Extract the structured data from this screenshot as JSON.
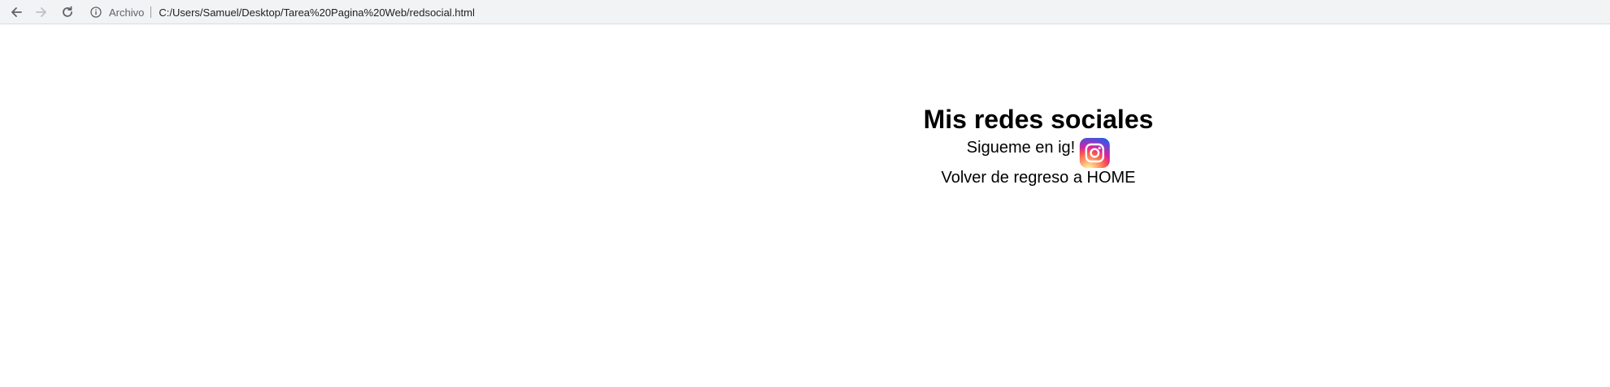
{
  "browser": {
    "scheme_label": "Archivo",
    "url": "C:/Users/Samuel/Desktop/Tarea%20Pagina%20Web/redsocial.html"
  },
  "page": {
    "title": "Mis redes sociales",
    "instagram_text": "Sigueme en ig!",
    "home_link": "Volver de regreso a HOME"
  },
  "icons": {
    "back": "arrow-left-icon",
    "forward": "arrow-right-icon",
    "reload": "reload-icon",
    "info": "info-icon",
    "instagram": "instagram-icon"
  }
}
